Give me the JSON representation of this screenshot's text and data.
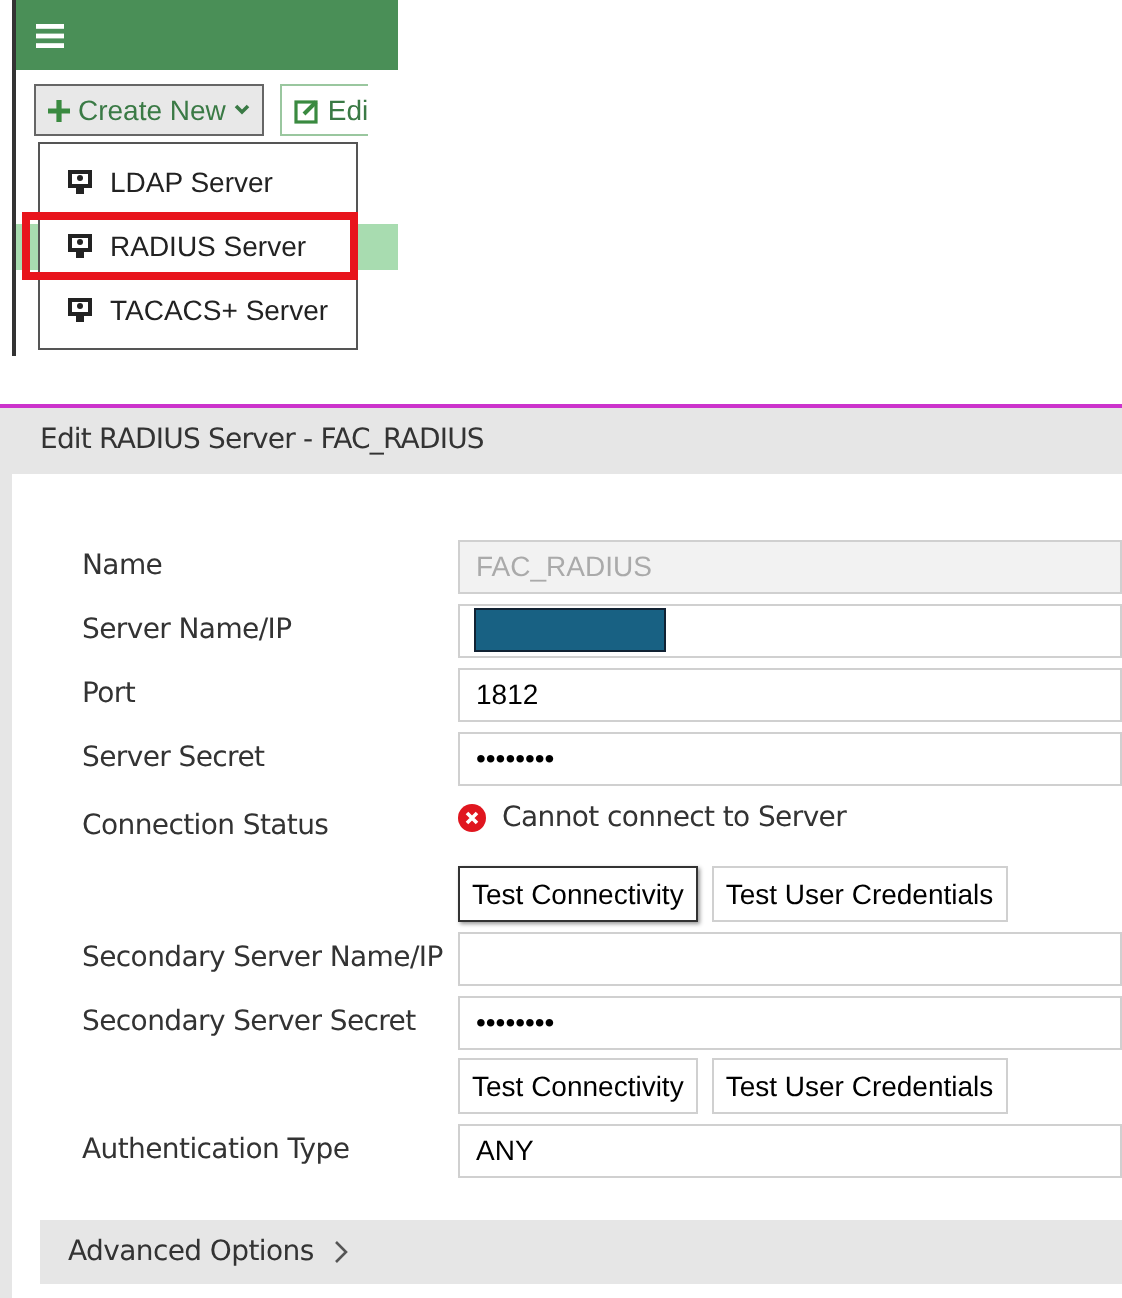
{
  "toolbar": {
    "buttons": [
      {
        "label": "Create New",
        "kind": "create"
      },
      {
        "label": "Edi",
        "kind": "edit"
      }
    ]
  },
  "dropdown": {
    "items": [
      {
        "label": "LDAP Server",
        "selected": false
      },
      {
        "label": "RADIUS Server",
        "selected": true
      },
      {
        "label": "TACACS+ Server",
        "selected": false
      }
    ]
  },
  "dialog": {
    "title": "Edit RADIUS Server - FAC_RADIUS",
    "rows": [
      {
        "kind": "field",
        "label": "Name",
        "value": "FAC_RADIUS",
        "disabled": true
      },
      {
        "kind": "redacted",
        "label": "Server Name/IP"
      },
      {
        "kind": "field",
        "label": "Port",
        "value": "1812",
        "disabled": false
      },
      {
        "kind": "field",
        "label": "Server Secret",
        "value": "••••••••",
        "disabled": false
      },
      {
        "kind": "status",
        "label": "Connection Status",
        "value": "Cannot connect to Server"
      },
      {
        "kind": "buttons",
        "buttons": [
          {
            "label": "Test Connectivity",
            "focused": true
          },
          {
            "label": "Test User Credentials",
            "focused": false
          }
        ]
      },
      {
        "kind": "field",
        "label": "Secondary Server Name/IP",
        "disabled": false
      },
      {
        "kind": "field",
        "label": "Secondary Server Secret",
        "value": "••••••••",
        "disabled": false
      },
      {
        "kind": "buttons",
        "buttons": [
          {
            "label": "Test Connectivity",
            "focused": false
          },
          {
            "label": "Test User Credentials",
            "focused": false
          }
        ]
      },
      {
        "kind": "field",
        "label": "Authentication Type",
        "value": "ANY",
        "disabled": false
      }
    ],
    "advanced": {
      "label": "Advanced Options"
    }
  }
}
